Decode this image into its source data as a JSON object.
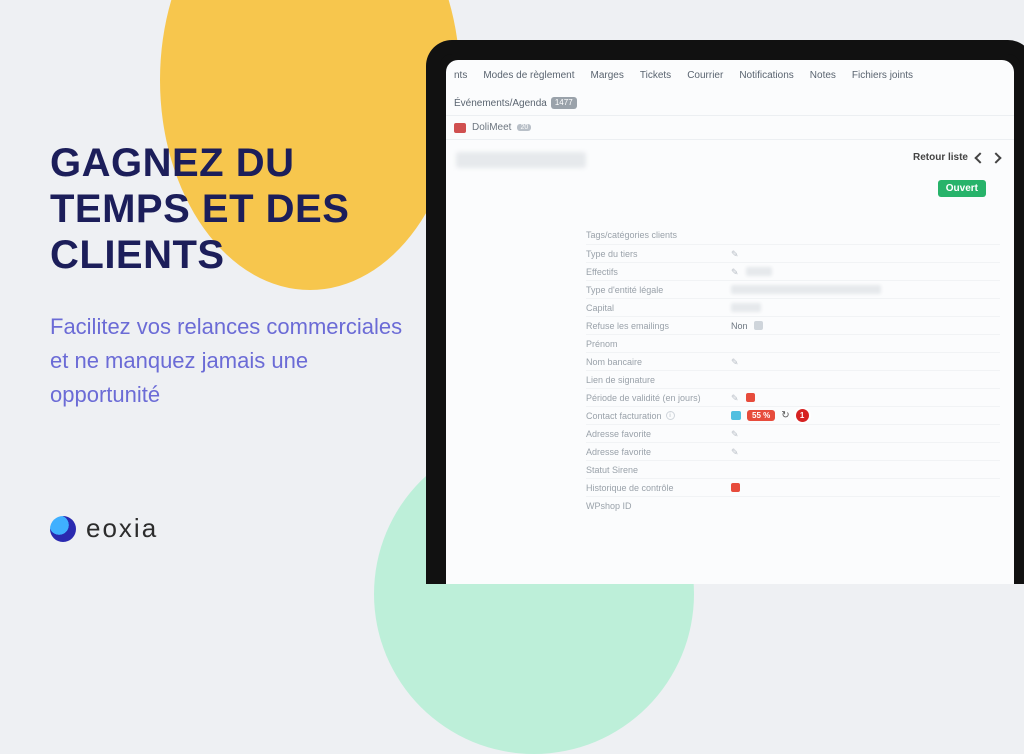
{
  "marketing": {
    "headline": "GAGNEZ DU TEMPS ET DES CLIENTS",
    "subline": "Facilitez vos relances commerciales et ne manquez jamais une opportunité",
    "brand": "eoxia"
  },
  "tabs": {
    "items": [
      "nts",
      "Modes de règlement",
      "Marges",
      "Tickets",
      "Courrier",
      "Notifications",
      "Notes",
      "Fichiers joints"
    ],
    "last_label": "Événements/Agenda",
    "last_count": "1477",
    "row2_label": "DoliMeet",
    "row2_count": "20"
  },
  "header": {
    "retour": "Retour liste",
    "open": "Ouvert"
  },
  "fields": [
    {
      "label": "Tags/catégories clients",
      "pencil": false
    },
    {
      "label": "Type du tiers",
      "pencil": true
    },
    {
      "label": "Effectifs",
      "pencil": true,
      "blur_w": 26
    },
    {
      "label": "Type d'entité légale",
      "pencil": false,
      "blur_w": 150
    },
    {
      "label": "Capital",
      "pencil": false,
      "blur_w": 30
    },
    {
      "label": "Refuse les emailings",
      "pencil": false,
      "value": "Non",
      "sq": true
    },
    {
      "label": "Prénom",
      "pencil": false
    },
    {
      "label": "Nom bancaire",
      "pencil": true
    },
    {
      "label": "Lien de signature",
      "pencil": false
    },
    {
      "label": "Période de validité (en jours)",
      "pencil": true,
      "red": true
    },
    {
      "label": "Contact facturation",
      "pencil": false,
      "info": true,
      "contact": true,
      "pct": "55 %",
      "count": "1"
    },
    {
      "label": "Adresse favorite",
      "pencil": true
    },
    {
      "label": "Adresse favorite",
      "pencil": true
    },
    {
      "label": "Statut Sirene",
      "pencil": false
    },
    {
      "label": "Historique de contrôle",
      "pencil": false,
      "red": true
    },
    {
      "label": "WPshop ID",
      "pencil": false
    }
  ]
}
